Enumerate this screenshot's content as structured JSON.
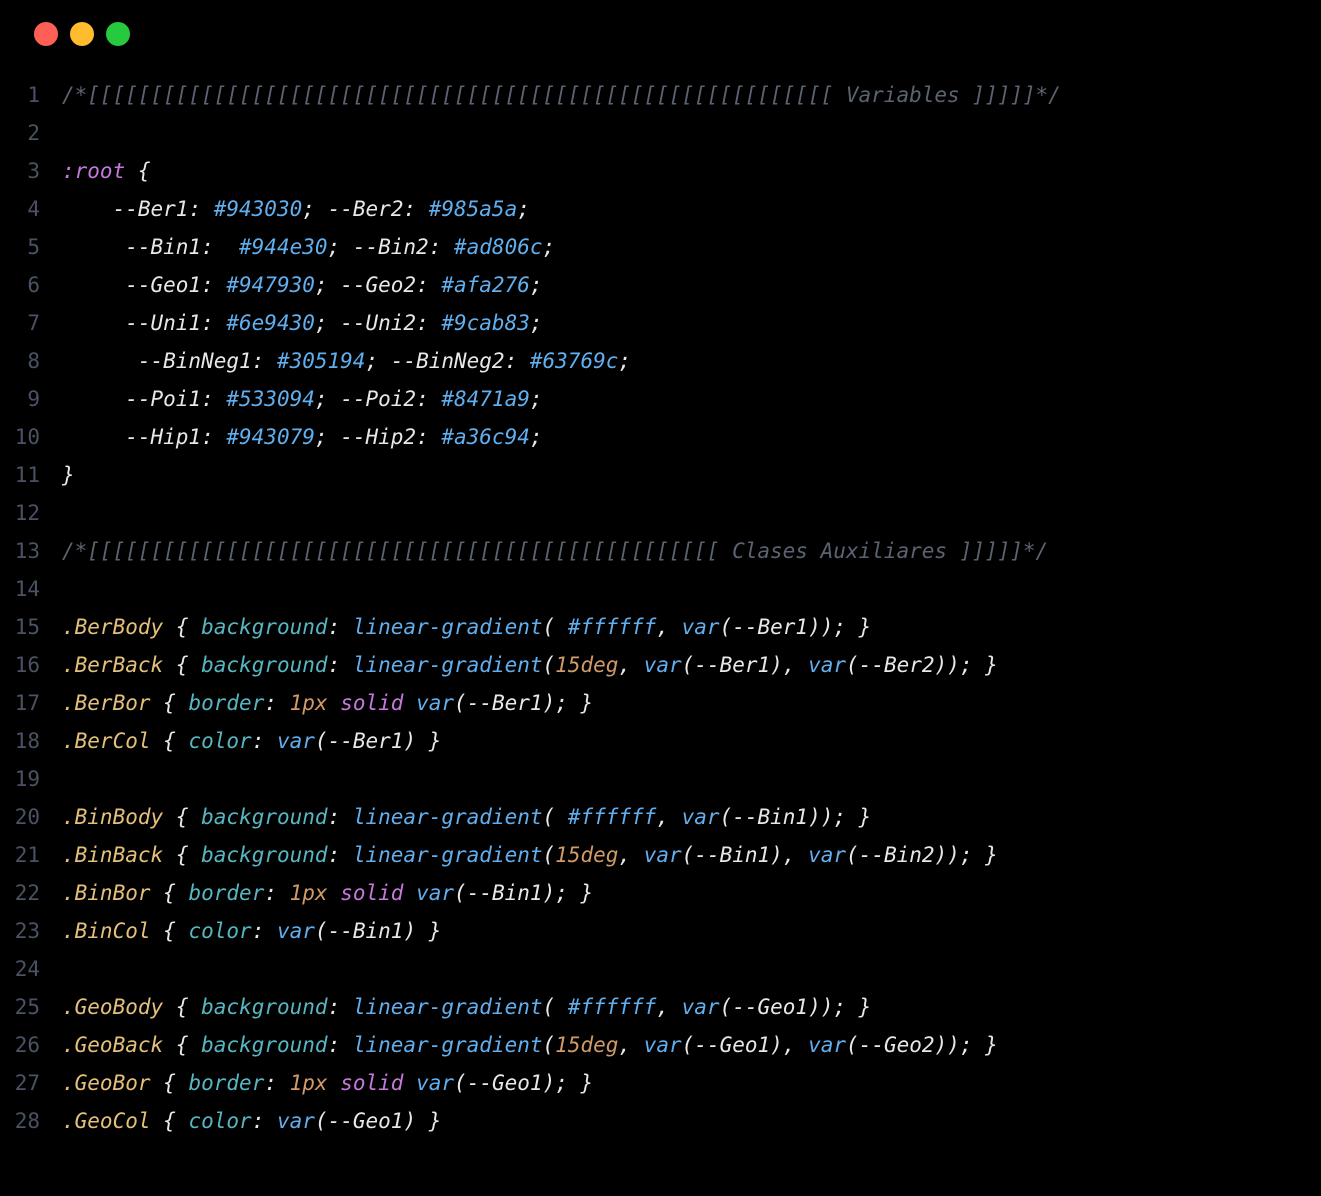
{
  "traffic_lights": [
    "red",
    "yellow",
    "green"
  ],
  "code": {
    "lines": [
      {
        "n": "1",
        "t": [
          [
            "/*[[[[[[[[[[[[[[[[[[[[[[[[[[[[[[[[[[[[[[[[[[[[[[[[[[[[[[[[[[[ Variables ]]]]]*/",
            "comment"
          ]
        ]
      },
      {
        "n": "2",
        "t": []
      },
      {
        "n": "3",
        "t": [
          [
            ":root",
            "pseudo"
          ],
          [
            " ",
            "white"
          ],
          [
            "{",
            "punct"
          ]
        ]
      },
      {
        "n": "4",
        "t": [
          [
            "    ",
            "white"
          ],
          [
            "--Ber1",
            "varname"
          ],
          [
            ": ",
            "punct"
          ],
          [
            "#943030",
            "hex"
          ],
          [
            ";",
            "punct"
          ],
          [
            " ",
            "white"
          ],
          [
            "--Ber2",
            "varname"
          ],
          [
            ": ",
            "punct"
          ],
          [
            "#985a5a",
            "hex"
          ],
          [
            ";",
            "punct"
          ]
        ]
      },
      {
        "n": "5",
        "t": [
          [
            "     ",
            "white"
          ],
          [
            "--Bin1",
            "varname"
          ],
          [
            ":  ",
            "punct"
          ],
          [
            "#944e30",
            "hex"
          ],
          [
            ";",
            "punct"
          ],
          [
            " ",
            "white"
          ],
          [
            "--Bin2",
            "varname"
          ],
          [
            ": ",
            "punct"
          ],
          [
            "#ad806c",
            "hex"
          ],
          [
            ";",
            "punct"
          ]
        ]
      },
      {
        "n": "6",
        "t": [
          [
            "     ",
            "white"
          ],
          [
            "--Geo1",
            "varname"
          ],
          [
            ": ",
            "punct"
          ],
          [
            "#947930",
            "hex"
          ],
          [
            ";",
            "punct"
          ],
          [
            " ",
            "white"
          ],
          [
            "--Geo2",
            "varname"
          ],
          [
            ": ",
            "punct"
          ],
          [
            "#afa276",
            "hex"
          ],
          [
            ";",
            "punct"
          ]
        ]
      },
      {
        "n": "7",
        "t": [
          [
            "     ",
            "white"
          ],
          [
            "--Uni1",
            "varname"
          ],
          [
            ": ",
            "punct"
          ],
          [
            "#6e9430",
            "hex"
          ],
          [
            ";",
            "punct"
          ],
          [
            " ",
            "white"
          ],
          [
            "--Uni2",
            "varname"
          ],
          [
            ": ",
            "punct"
          ],
          [
            "#9cab83",
            "hex"
          ],
          [
            ";",
            "punct"
          ]
        ]
      },
      {
        "n": "8",
        "t": [
          [
            "      ",
            "white"
          ],
          [
            "--BinNeg1",
            "varname"
          ],
          [
            ": ",
            "punct"
          ],
          [
            "#305194",
            "hex"
          ],
          [
            ";",
            "punct"
          ],
          [
            " ",
            "white"
          ],
          [
            "--BinNeg2",
            "varname"
          ],
          [
            ": ",
            "punct"
          ],
          [
            "#63769c",
            "hex"
          ],
          [
            ";",
            "punct"
          ]
        ]
      },
      {
        "n": "9",
        "t": [
          [
            "     ",
            "white"
          ],
          [
            "--Poi1",
            "varname"
          ],
          [
            ": ",
            "punct"
          ],
          [
            "#533094",
            "hex"
          ],
          [
            ";",
            "punct"
          ],
          [
            " ",
            "white"
          ],
          [
            "--Poi2",
            "varname"
          ],
          [
            ": ",
            "punct"
          ],
          [
            "#8471a9",
            "hex"
          ],
          [
            ";",
            "punct"
          ]
        ]
      },
      {
        "n": "10",
        "t": [
          [
            "     ",
            "white"
          ],
          [
            "--Hip1",
            "varname"
          ],
          [
            ": ",
            "punct"
          ],
          [
            "#943079",
            "hex"
          ],
          [
            ";",
            "punct"
          ],
          [
            " ",
            "white"
          ],
          [
            "--Hip2",
            "varname"
          ],
          [
            ": ",
            "punct"
          ],
          [
            "#a36c94",
            "hex"
          ],
          [
            ";",
            "punct"
          ]
        ]
      },
      {
        "n": "11",
        "t": [
          [
            "}",
            "punct"
          ]
        ]
      },
      {
        "n": "12",
        "t": []
      },
      {
        "n": "13",
        "t": [
          [
            "/*[[[[[[[[[[[[[[[[[[[[[[[[[[[[[[[[[[[[[[[[[[[[[[[[[[ Clases Auxiliares ]]]]]*/",
            "comment"
          ]
        ]
      },
      {
        "n": "14",
        "t": []
      },
      {
        "n": "15",
        "t": [
          [
            ".BerBody",
            "selector"
          ],
          [
            " ",
            "white"
          ],
          [
            "{",
            "punct"
          ],
          [
            " ",
            "white"
          ],
          [
            "background",
            "prop"
          ],
          [
            ": ",
            "punct"
          ],
          [
            "linear-gradient",
            "func"
          ],
          [
            "( ",
            "punct"
          ],
          [
            "#ffffff",
            "hex"
          ],
          [
            ", ",
            "punct"
          ],
          [
            "var",
            "func"
          ],
          [
            "(",
            "punct"
          ],
          [
            "--Ber1",
            "varname"
          ],
          [
            "));",
            "punct"
          ],
          [
            " ",
            "white"
          ],
          [
            "}",
            "punct"
          ]
        ]
      },
      {
        "n": "16",
        "t": [
          [
            ".BerBack",
            "selector"
          ],
          [
            " ",
            "white"
          ],
          [
            "{",
            "punct"
          ],
          [
            " ",
            "white"
          ],
          [
            "background",
            "prop"
          ],
          [
            ": ",
            "punct"
          ],
          [
            "linear-gradient",
            "func"
          ],
          [
            "(",
            "punct"
          ],
          [
            "15deg",
            "num"
          ],
          [
            ", ",
            "punct"
          ],
          [
            "var",
            "func"
          ],
          [
            "(",
            "punct"
          ],
          [
            "--Ber1",
            "varname"
          ],
          [
            "), ",
            "punct"
          ],
          [
            "var",
            "func"
          ],
          [
            "(",
            "punct"
          ],
          [
            "--Ber2",
            "varname"
          ],
          [
            "));",
            "punct"
          ],
          [
            " ",
            "white"
          ],
          [
            "}",
            "punct"
          ]
        ]
      },
      {
        "n": "17",
        "t": [
          [
            ".BerBor",
            "selector"
          ],
          [
            " ",
            "white"
          ],
          [
            "{",
            "punct"
          ],
          [
            " ",
            "white"
          ],
          [
            "border",
            "prop"
          ],
          [
            ": ",
            "punct"
          ],
          [
            "1px",
            "num"
          ],
          [
            " ",
            "white"
          ],
          [
            "solid",
            "kw"
          ],
          [
            " ",
            "white"
          ],
          [
            "var",
            "func"
          ],
          [
            "(",
            "punct"
          ],
          [
            "--Ber1",
            "varname"
          ],
          [
            ");",
            "punct"
          ],
          [
            " ",
            "white"
          ],
          [
            "}",
            "punct"
          ]
        ]
      },
      {
        "n": "18",
        "t": [
          [
            ".BerCol",
            "selector"
          ],
          [
            " ",
            "white"
          ],
          [
            "{",
            "punct"
          ],
          [
            " ",
            "white"
          ],
          [
            "color",
            "prop"
          ],
          [
            ": ",
            "punct"
          ],
          [
            "var",
            "func"
          ],
          [
            "(",
            "punct"
          ],
          [
            "--Ber1",
            "varname"
          ],
          [
            ")",
            "punct"
          ],
          [
            " ",
            "white"
          ],
          [
            "}",
            "punct"
          ]
        ]
      },
      {
        "n": "19",
        "t": []
      },
      {
        "n": "20",
        "t": [
          [
            ".BinBody",
            "selector"
          ],
          [
            " ",
            "white"
          ],
          [
            "{",
            "punct"
          ],
          [
            " ",
            "white"
          ],
          [
            "background",
            "prop"
          ],
          [
            ": ",
            "punct"
          ],
          [
            "linear-gradient",
            "func"
          ],
          [
            "( ",
            "punct"
          ],
          [
            "#ffffff",
            "hex"
          ],
          [
            ", ",
            "punct"
          ],
          [
            "var",
            "func"
          ],
          [
            "(",
            "punct"
          ],
          [
            "--Bin1",
            "varname"
          ],
          [
            "));",
            "punct"
          ],
          [
            " ",
            "white"
          ],
          [
            "}",
            "punct"
          ]
        ]
      },
      {
        "n": "21",
        "t": [
          [
            ".BinBack",
            "selector"
          ],
          [
            " ",
            "white"
          ],
          [
            "{",
            "punct"
          ],
          [
            " ",
            "white"
          ],
          [
            "background",
            "prop"
          ],
          [
            ": ",
            "punct"
          ],
          [
            "linear-gradient",
            "func"
          ],
          [
            "(",
            "punct"
          ],
          [
            "15deg",
            "num"
          ],
          [
            ", ",
            "punct"
          ],
          [
            "var",
            "func"
          ],
          [
            "(",
            "punct"
          ],
          [
            "--Bin1",
            "varname"
          ],
          [
            "), ",
            "punct"
          ],
          [
            "var",
            "func"
          ],
          [
            "(",
            "punct"
          ],
          [
            "--Bin2",
            "varname"
          ],
          [
            "));",
            "punct"
          ],
          [
            " ",
            "white"
          ],
          [
            "}",
            "punct"
          ]
        ]
      },
      {
        "n": "22",
        "t": [
          [
            ".BinBor",
            "selector"
          ],
          [
            " ",
            "white"
          ],
          [
            "{",
            "punct"
          ],
          [
            " ",
            "white"
          ],
          [
            "border",
            "prop"
          ],
          [
            ": ",
            "punct"
          ],
          [
            "1px",
            "num"
          ],
          [
            " ",
            "white"
          ],
          [
            "solid",
            "kw"
          ],
          [
            " ",
            "white"
          ],
          [
            "var",
            "func"
          ],
          [
            "(",
            "punct"
          ],
          [
            "--Bin1",
            "varname"
          ],
          [
            ");",
            "punct"
          ],
          [
            " ",
            "white"
          ],
          [
            "}",
            "punct"
          ]
        ]
      },
      {
        "n": "23",
        "t": [
          [
            ".BinCol",
            "selector"
          ],
          [
            " ",
            "white"
          ],
          [
            "{",
            "punct"
          ],
          [
            " ",
            "white"
          ],
          [
            "color",
            "prop"
          ],
          [
            ": ",
            "punct"
          ],
          [
            "var",
            "func"
          ],
          [
            "(",
            "punct"
          ],
          [
            "--Bin1",
            "varname"
          ],
          [
            ")",
            "punct"
          ],
          [
            " ",
            "white"
          ],
          [
            "}",
            "punct"
          ]
        ]
      },
      {
        "n": "24",
        "t": []
      },
      {
        "n": "25",
        "t": [
          [
            ".GeoBody",
            "selector"
          ],
          [
            " ",
            "white"
          ],
          [
            "{",
            "punct"
          ],
          [
            " ",
            "white"
          ],
          [
            "background",
            "prop"
          ],
          [
            ": ",
            "punct"
          ],
          [
            "linear-gradient",
            "func"
          ],
          [
            "( ",
            "punct"
          ],
          [
            "#ffffff",
            "hex"
          ],
          [
            ", ",
            "punct"
          ],
          [
            "var",
            "func"
          ],
          [
            "(",
            "punct"
          ],
          [
            "--Geo1",
            "varname"
          ],
          [
            "));",
            "punct"
          ],
          [
            " ",
            "white"
          ],
          [
            "}",
            "punct"
          ]
        ]
      },
      {
        "n": "26",
        "t": [
          [
            ".GeoBack",
            "selector"
          ],
          [
            " ",
            "white"
          ],
          [
            "{",
            "punct"
          ],
          [
            " ",
            "white"
          ],
          [
            "background",
            "prop"
          ],
          [
            ": ",
            "punct"
          ],
          [
            "linear-gradient",
            "func"
          ],
          [
            "(",
            "punct"
          ],
          [
            "15deg",
            "num"
          ],
          [
            ", ",
            "punct"
          ],
          [
            "var",
            "func"
          ],
          [
            "(",
            "punct"
          ],
          [
            "--Geo1",
            "varname"
          ],
          [
            "), ",
            "punct"
          ],
          [
            "var",
            "func"
          ],
          [
            "(",
            "punct"
          ],
          [
            "--Geo2",
            "varname"
          ],
          [
            "));",
            "punct"
          ],
          [
            " ",
            "white"
          ],
          [
            "}",
            "punct"
          ]
        ]
      },
      {
        "n": "27",
        "t": [
          [
            ".GeoBor",
            "selector"
          ],
          [
            " ",
            "white"
          ],
          [
            "{",
            "punct"
          ],
          [
            " ",
            "white"
          ],
          [
            "border",
            "prop"
          ],
          [
            ": ",
            "punct"
          ],
          [
            "1px",
            "num"
          ],
          [
            " ",
            "white"
          ],
          [
            "solid",
            "kw"
          ],
          [
            " ",
            "white"
          ],
          [
            "var",
            "func"
          ],
          [
            "(",
            "punct"
          ],
          [
            "--Geo1",
            "varname"
          ],
          [
            ");",
            "punct"
          ],
          [
            " ",
            "white"
          ],
          [
            "}",
            "punct"
          ]
        ]
      },
      {
        "n": "28",
        "t": [
          [
            ".GeoCol",
            "selector"
          ],
          [
            " ",
            "white"
          ],
          [
            "{",
            "punct"
          ],
          [
            " ",
            "white"
          ],
          [
            "color",
            "prop"
          ],
          [
            ": ",
            "punct"
          ],
          [
            "var",
            "func"
          ],
          [
            "(",
            "punct"
          ],
          [
            "--Geo1",
            "varname"
          ],
          [
            ")",
            "punct"
          ],
          [
            " ",
            "white"
          ],
          [
            "}",
            "punct"
          ]
        ]
      }
    ]
  }
}
